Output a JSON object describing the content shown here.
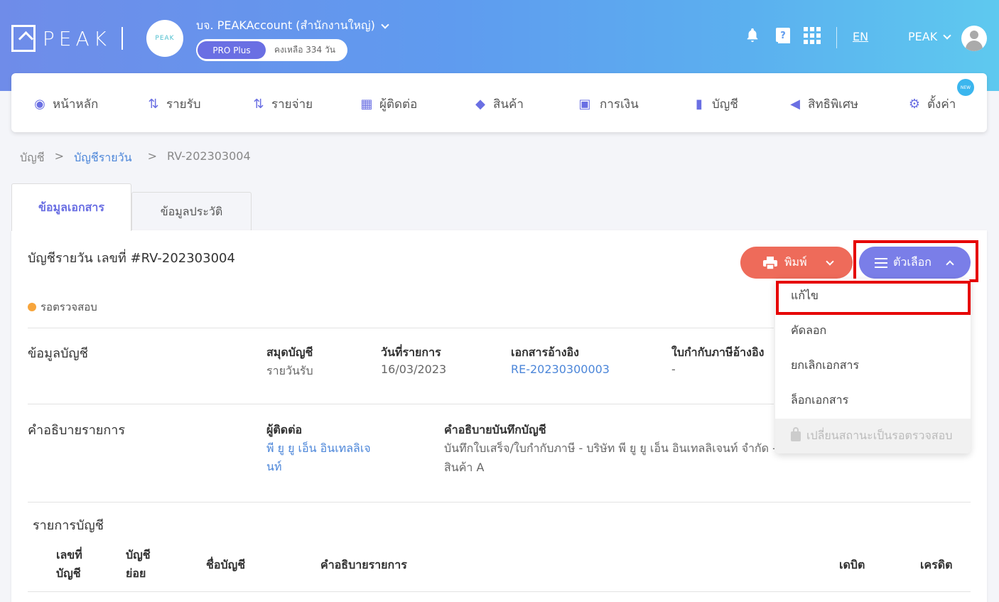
{
  "header": {
    "logo_text": "PEAK",
    "company_avatar_text": "PEAK",
    "company_name": "บจ. PEAKAccount (สำนักงานใหญ่)",
    "plan_badge": "PRO Plus",
    "plan_remaining": "คงเหลือ 334 วัน",
    "language": "EN",
    "user_name": "PEAK"
  },
  "nav": {
    "items": [
      {
        "label": "หน้าหลัก",
        "icon": "dashboard-icon"
      },
      {
        "label": "รายรับ",
        "icon": "income-icon"
      },
      {
        "label": "รายจ่าย",
        "icon": "expense-icon"
      },
      {
        "label": "ผู้ติดต่อ",
        "icon": "contacts-icon"
      },
      {
        "label": "สินค้า",
        "icon": "product-box-icon"
      },
      {
        "label": "การเงิน",
        "icon": "money-icon"
      },
      {
        "label": "บัญชี",
        "icon": "ledger-icon"
      },
      {
        "label": "สิทธิพิเศษ",
        "icon": "megaphone-icon"
      },
      {
        "label": "ตั้งค่า",
        "icon": "gear-icon"
      }
    ],
    "new_badge": "NEW"
  },
  "breadcrumb": {
    "root": "บัญชี",
    "sep": ">",
    "parent": "บัญชีรายวัน",
    "current": "RV-202303004"
  },
  "tabs": {
    "document": "ข้อมูลเอกสาร",
    "history": "ข้อมูลประวัติ"
  },
  "document": {
    "title": "บัญชีรายวัน เลขที่ #RV-202303004",
    "status": "รอตรวจสอบ",
    "print_label": "พิมพ์",
    "options_label": "ตัวเลือก"
  },
  "options_menu": {
    "edit": "แก้ไข",
    "copy": "คัดลอก",
    "cancel_doc": "ยกเลิกเอกสาร",
    "lock_doc": "ล็อกเอกสาร",
    "change_status": "เปลี่ยนสถานะเป็นรอตรวจสอบ"
  },
  "account_info": {
    "section_title": "ข้อมูลบัญชี",
    "journal_label": "สมุดบัญชี",
    "journal_value": "รายวันรับ",
    "date_label": "วันที่รายการ",
    "date_value": "16/03/2023",
    "ref_label": "เอกสารอ้างอิง",
    "ref_value": "RE-20230300003",
    "tax_label": "ใบกำกับภาษีอ้างอิง",
    "tax_value": "-"
  },
  "description": {
    "section_title": "คำอธิบายรายการ",
    "contact_label": "ผู้ติดต่อ",
    "contact_line1": "พี ยู ยู เอ็น อินเทลลิเจ",
    "contact_line2": "นท์",
    "note_label": "คำอธิบายบันทึกบัญชี",
    "note_line1": "บันทึกใบเสร็จ/ใบกำกับภาษี - บริษัท พี ยู ยู เอ็น อินเทลลิเจนท์ จำกัด -",
    "note_line2": "สินค้า A"
  },
  "entries": {
    "section_title": "รายการบัญชี",
    "col_account_no_1": "เลขที่",
    "col_account_no_2": "บัญชี",
    "col_sub_1": "บัญชี",
    "col_sub_2": "ย่อย",
    "col_account_name": "ชื่อบัญชี",
    "col_description": "คำอธิบายรายการ",
    "col_debit": "เดบิต",
    "col_credit": "เครดิต"
  },
  "colors": {
    "primary": "#6a6fe3",
    "print_button": "#ee6b5a",
    "status_pending": "#f7a53c",
    "link": "#4c86d9",
    "highlight": "#e60000"
  }
}
